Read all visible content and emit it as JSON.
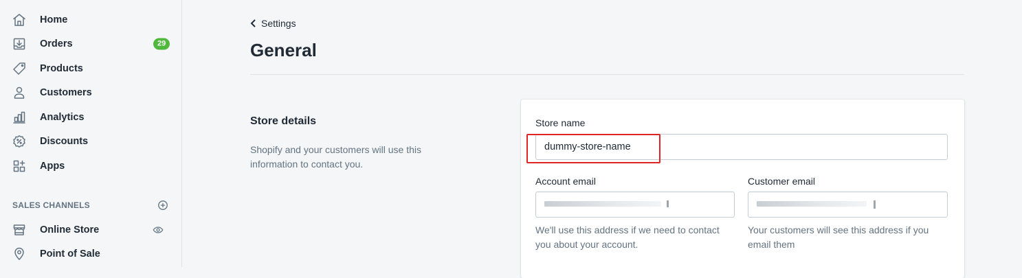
{
  "sidebar": {
    "items": [
      {
        "label": "Home",
        "icon": "home-icon"
      },
      {
        "label": "Orders",
        "icon": "orders-icon",
        "badge": "29"
      },
      {
        "label": "Products",
        "icon": "tag-icon"
      },
      {
        "label": "Customers",
        "icon": "person-icon"
      },
      {
        "label": "Analytics",
        "icon": "bar-chart-icon"
      },
      {
        "label": "Discounts",
        "icon": "discount-icon"
      },
      {
        "label": "Apps",
        "icon": "apps-icon"
      }
    ],
    "sales_channels": {
      "title": "SALES CHANNELS",
      "items": [
        {
          "label": "Online Store",
          "icon": "store-icon"
        },
        {
          "label": "Point of Sale",
          "icon": "location-pin-icon"
        }
      ]
    }
  },
  "header": {
    "back_label": "Settings",
    "title": "General"
  },
  "store_details": {
    "title": "Store details",
    "description": "Shopify and your customers will use this information to contact you.",
    "store_name": {
      "label": "Store name",
      "value": "dummy-store-name"
    },
    "account_email": {
      "label": "Account email",
      "value": "",
      "help": "We'll use this address if we need to contact you about your account."
    },
    "customer_email": {
      "label": "Customer email",
      "value": "",
      "help": "Your customers will see this address if you email them"
    }
  },
  "colors": {
    "badge": "#50b83c",
    "highlight": "#e02424",
    "background": "#f4f6f8"
  }
}
